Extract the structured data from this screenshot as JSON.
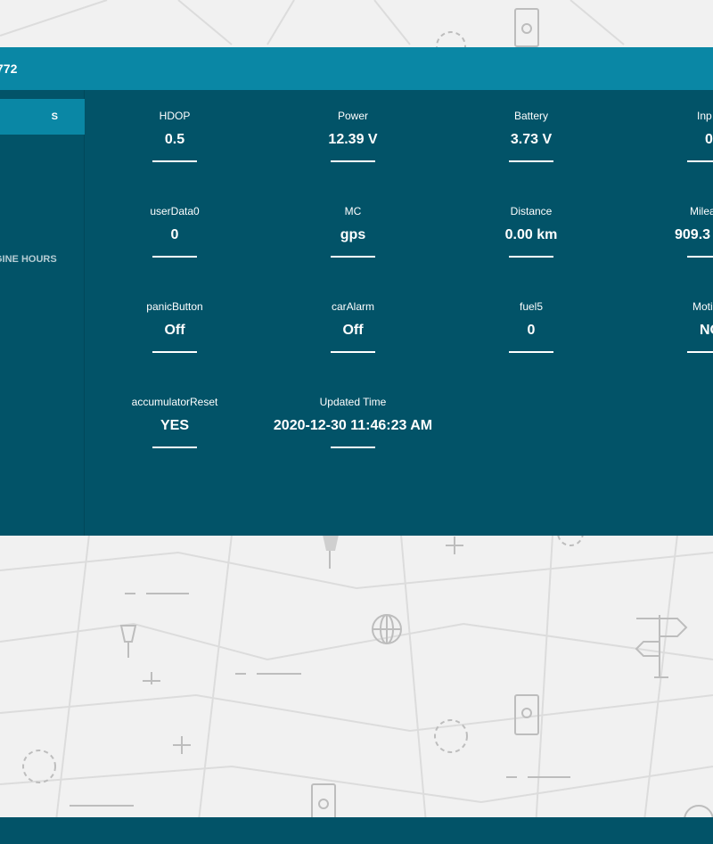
{
  "header": {
    "title": "772"
  },
  "sidebar": {
    "items": [
      {
        "label": "S"
      },
      {
        "label": "GINE HOURS"
      }
    ]
  },
  "fields": [
    {
      "label": "HDOP",
      "value": "0.5"
    },
    {
      "label": "Power",
      "value": "12.39 V"
    },
    {
      "label": "Battery",
      "value": "3.73 V"
    },
    {
      "label": "Inp",
      "value": "0"
    },
    {
      "label": "userData0",
      "value": "0"
    },
    {
      "label": "MC",
      "value": "gps"
    },
    {
      "label": "Distance",
      "value": "0.00 km"
    },
    {
      "label": "Milea",
      "value": "909.3"
    },
    {
      "label": "panicButton",
      "value": "Off"
    },
    {
      "label": "carAlarm",
      "value": "Off"
    },
    {
      "label": "fuel5",
      "value": "0"
    },
    {
      "label": "Moti",
      "value": "NO"
    },
    {
      "label": "accumulatorReset",
      "value": "YES"
    },
    {
      "label": "Updated Time",
      "value": "2020-12-30 11:46:23 AM"
    }
  ]
}
